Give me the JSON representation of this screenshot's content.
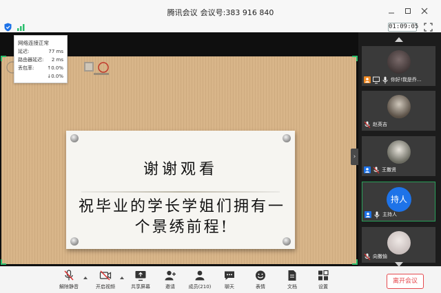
{
  "window": {
    "app_name": "腾讯会议",
    "meeting_id_label": "会议号:",
    "meeting_id": "383 916 840"
  },
  "status": {
    "timer": "01:09:05"
  },
  "network_popup": {
    "title": "网络连接正常",
    "rows": [
      {
        "label": "延迟:",
        "value": "77 ms"
      },
      {
        "label": "路由器延迟:",
        "value": "2 ms"
      },
      {
        "label": "丢包率:",
        "value": "↑0.0%"
      },
      {
        "label": "",
        "value": "↓0.0%"
      }
    ]
  },
  "slide": {
    "title": "谢谢观看",
    "line1": "祝毕业的学长学姐们拥有一",
    "line2": "个景绣前程!"
  },
  "participants": [
    {
      "name": "你好!我是乔...",
      "badge_color": "#f08a24",
      "avatar_color": "#4a3a3a"
    },
    {
      "name": "赵英吉",
      "badge_color": "",
      "avatar_color": "#5a5046"
    },
    {
      "name": "王撒贤",
      "badge_color": "#1e73e8",
      "avatar_color": "#6a6a60"
    },
    {
      "name": "主持人",
      "badge_color": "#1e73e8",
      "avatar_text": "持人",
      "avatar_color": "#1e73e8"
    },
    {
      "name": "向撒愉",
      "badge_color": "",
      "avatar_color": "#c9bfbd"
    }
  ],
  "toolbar": {
    "mute_label": "解除静音",
    "video_label": "开启视频",
    "share_label": "共享屏幕",
    "invite_label": "邀请",
    "members_label": "成员(210)",
    "chat_label": "聊天",
    "reaction_label": "表情",
    "docs_label": "文档",
    "settings_label": "设置",
    "leave_label": "离开会议"
  },
  "colors": {
    "accent": "#1e73e8",
    "leave": "#e5484d",
    "mic_off": "#d93030",
    "active_border": "#2bbf6e"
  }
}
